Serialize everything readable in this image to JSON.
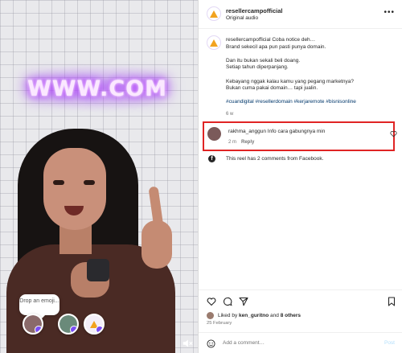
{
  "video": {
    "overlay_text": "WWW.COM",
    "emoji_tip": "Drop an emoji..."
  },
  "header": {
    "username": "resellercampofficial",
    "subtitle": "Original audio",
    "more_icon": "more-options-icon"
  },
  "caption": {
    "username": "resellercampofficial",
    "lines": [
      "Coba notice deh…\nBrand sekecil apa pun pasti punya domain.",
      "Dan itu bukan sekali beli doang.\nSetiap tahun diperpanjang.",
      "Kebayang nggak kalau kamu yang pegang marketnya?\nBukan cuma pakai domain… tapi jualin."
    ],
    "hashtags": "#cuandigital #resellerdomain #kerjaremote #bisnisonline",
    "time": "6 w"
  },
  "comment": {
    "username": "rakhma_anggun",
    "text": "Info cara gabungnya min",
    "time": "2 m",
    "reply_label": "Reply"
  },
  "facebook_note": "This reel has 2 comments from Facebook.",
  "likes": {
    "prefix": "Liked by ",
    "user": "ken_guritno",
    "middle": " and ",
    "others": "8 others",
    "date": "25 February"
  },
  "add_comment": {
    "placeholder": "Add a comment…",
    "post_label": "Post"
  },
  "colors": {
    "accent_link": "#00376b",
    "highlight_box": "#e02424",
    "neon": "#a12cff"
  }
}
